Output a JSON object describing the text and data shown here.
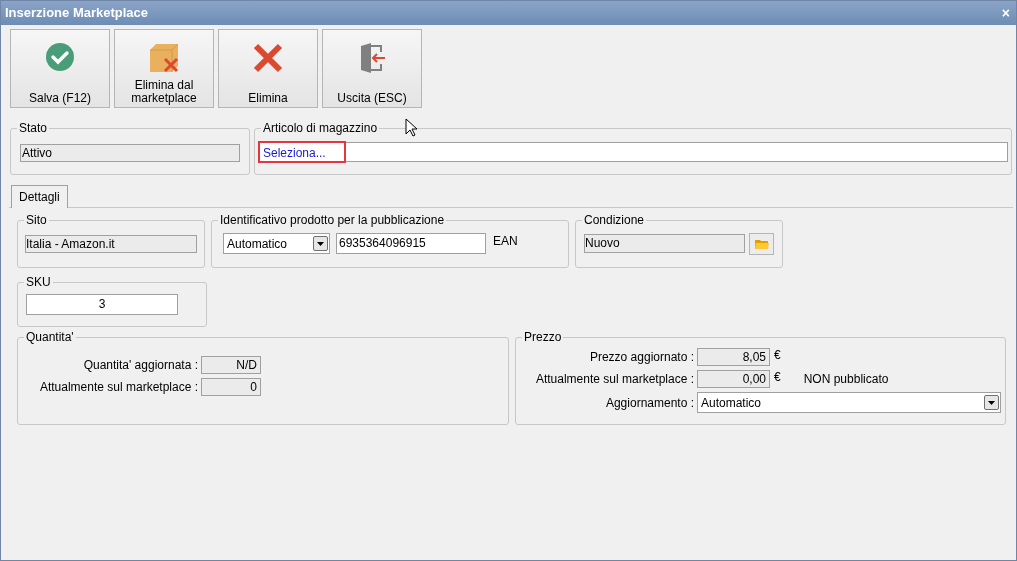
{
  "window": {
    "title": "Inserzione Marketplace",
    "close": "×"
  },
  "toolbar": [
    {
      "kind": "save",
      "label": "Salva (F12)"
    },
    {
      "kind": "remove_marketplace",
      "label": "Elimina dal marketplace"
    },
    {
      "kind": "delete",
      "label": "Elimina"
    },
    {
      "kind": "exit",
      "label": "Uscita (ESC)"
    }
  ],
  "stato": {
    "title": "Stato",
    "value": "Attivo"
  },
  "articolo": {
    "title": "Articolo di magazzino",
    "value": "Seleziona...",
    "highlighted": true
  },
  "tabs": [
    {
      "label": "Dettagli",
      "selected": true
    }
  ],
  "sito": {
    "title": "Sito",
    "value": "Italia - Amazon.it"
  },
  "identificativo": {
    "title": "Identificativo prodotto per la pubblicazione",
    "mode": "Automatico",
    "code": "6935364096915",
    "type": "EAN"
  },
  "condizione": {
    "title": "Condizione",
    "value": "Nuovo"
  },
  "sku": {
    "title": "SKU",
    "value": "3"
  },
  "quantita": {
    "title": "Quantita'",
    "rows": [
      {
        "label": "Quantita' aggiornata :",
        "value": "N/D"
      },
      {
        "label": "Attualmente sul marketplace :",
        "value": "0"
      }
    ]
  },
  "prezzo": {
    "title": "Prezzo",
    "rows": [
      {
        "label": "Prezzo aggiornato :",
        "value": "8,05",
        "unit": "€"
      },
      {
        "label": "Attualmente sul marketplace :",
        "value": "0,00",
        "unit": "€",
        "note": "NON pubblicato"
      }
    ],
    "update_label": "Aggiornamento :",
    "update_value": "Automatico"
  }
}
